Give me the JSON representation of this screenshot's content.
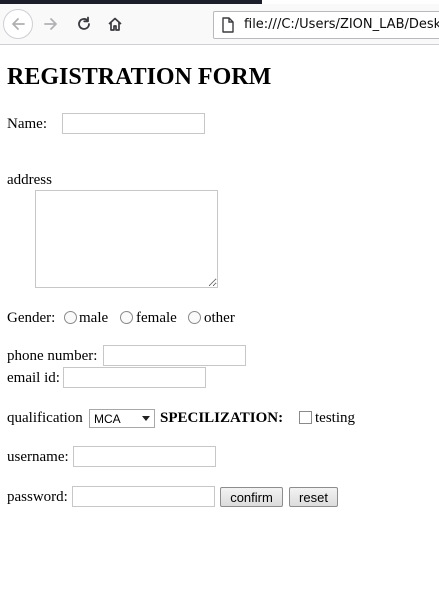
{
  "browser": {
    "url": "file:///C:/Users/ZION_LAB/Deskt"
  },
  "form": {
    "title": "REGISTRATION FORM",
    "name_label": "Name:",
    "address_label": "address",
    "gender_label": "Gender:",
    "gender_options": [
      "male",
      "female",
      "other"
    ],
    "phone_label": "phone number:",
    "email_label": "email id:",
    "qualification_label": "qualification",
    "qualification_selected": "MCA",
    "specialization_label": "SPECILIZATION:",
    "specialization_option": "testing",
    "username_label": "username:",
    "password_label": "password:",
    "confirm_button": "confirm",
    "reset_button": "reset"
  }
}
